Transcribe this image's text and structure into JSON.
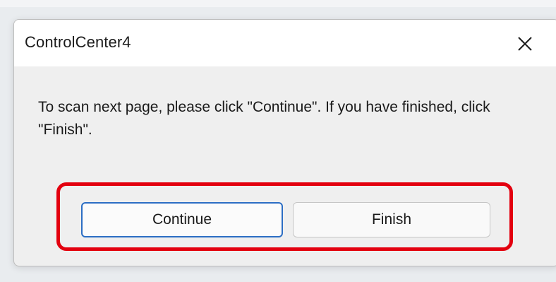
{
  "dialog": {
    "title": "ControlCenter4",
    "close_icon": "close-icon",
    "message": "To scan next page, please click \"Continue\".  If you have finished, click \"Finish\".",
    "buttons": {
      "continue_label": "Continue",
      "finish_label": "Finish"
    }
  },
  "colors": {
    "highlight": "#e3000f",
    "focus_border": "#2c6ec4",
    "dialog_background": "#efefef"
  }
}
